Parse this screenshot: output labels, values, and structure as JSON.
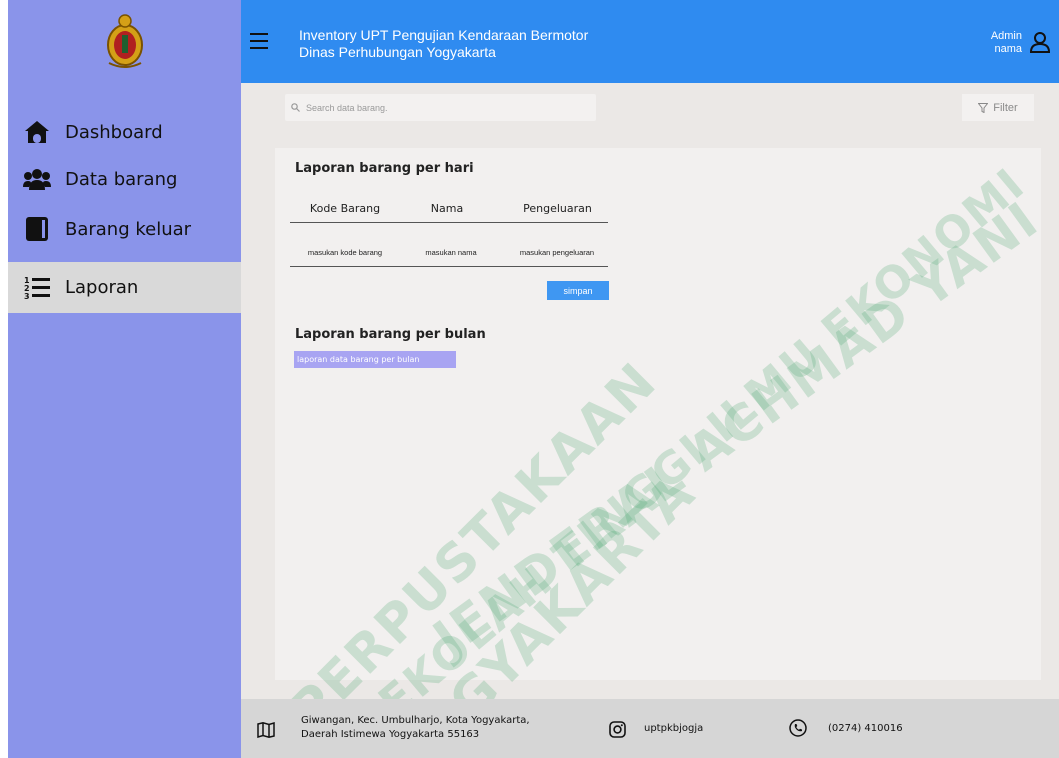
{
  "header": {
    "title_line1": "Inventory UPT Pengujian Kendaraan Bermotor",
    "title_line2": "Dinas Perhubungan Yogyakarta",
    "admin_label": "Admin",
    "admin_name": "nama"
  },
  "sidebar": {
    "items": [
      {
        "label": "Dashboard",
        "icon": "home-icon"
      },
      {
        "label": "Data barang",
        "icon": "users-icon"
      },
      {
        "label": "Barang keluar",
        "icon": "book-icon"
      },
      {
        "label": "Laporan",
        "icon": "numbered-list-icon"
      }
    ],
    "active": "Laporan"
  },
  "search": {
    "placeholder": "Search data barang."
  },
  "filter": {
    "label": "Filter"
  },
  "daily_report": {
    "title": "Laporan barang per hari",
    "columns": [
      "Kode Barang",
      "Nama",
      "Pengeluaran"
    ],
    "inputs": [
      "masukan kode barang",
      "masukan nama",
      "masukan pengeluaran"
    ],
    "save_label": "simpan"
  },
  "monthly_report": {
    "title": "Laporan barang per bulan",
    "button_label": "laporan data barang per bulan"
  },
  "watermark": {
    "line1": "PERPUSTAKAAN",
    "line2": "SEKOLAH TINGGI ILMU EKONOMI",
    "line3": "YOGYAKARTA",
    "line4": "JENDERAL ACHMAD YANI"
  },
  "footer": {
    "address_line1": "Giwangan, Kec. Umbulharjo, Kota Yogyakarta,",
    "address_line2": "Daerah Istimewa Yogyakarta 55163",
    "instagram": "uptpkbjogja",
    "phone": "(0274) 410016"
  },
  "colors": {
    "sidebar": "#8a94ea",
    "header": "#2f8bf0",
    "save_button": "#3f97f2",
    "monthly_button": "#a8a4f2",
    "active_nav": "#d9d9d9"
  }
}
